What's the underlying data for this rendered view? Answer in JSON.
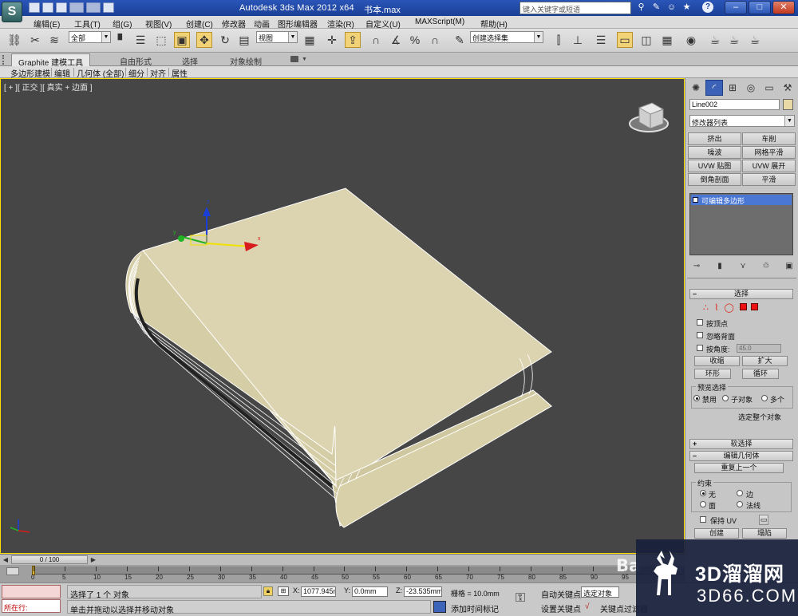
{
  "titlebar": {
    "logo": "S",
    "title": "Autodesk 3ds Max  2012 x64",
    "file": "书本.max",
    "search_placeholder": "键入关键字或短语",
    "icons": [
      "binoculars-icon",
      "wrench-icon",
      "person-icon",
      "star-icon",
      "help-icon"
    ],
    "window_buttons": [
      "–",
      "□",
      "✕"
    ]
  },
  "menubar": {
    "items": [
      "编辑(E)",
      "工具(T)",
      "组(G)",
      "视图(V)",
      "创建(C)",
      "修改器",
      "动画",
      "图形编辑器",
      "渲染(R)",
      "自定义(U)",
      "MAXScript(M)",
      "帮助(H)"
    ]
  },
  "toolbar": {
    "selection_filter": "全部",
    "coord_system": "视图",
    "named_selection": "创建选择集"
  },
  "ribbon": {
    "tabs": [
      "Graphite 建模工具",
      "自由形式",
      "选择",
      "对象绘制"
    ],
    "subtabs": [
      "多边形建模",
      "编辑",
      "几何体 (全部)",
      "细分",
      "对齐",
      "属性"
    ]
  },
  "viewport": {
    "label": "[ + ][ 正交 ][ 真实 + 边面 ]",
    "gizmo_axes": [
      "x",
      "y",
      "z"
    ],
    "colors": {
      "bg": "#464646",
      "book_top": "#dcd4b0",
      "book_edge": "#ffffff"
    }
  },
  "cmdpanel": {
    "tab_icons": [
      "sun-icon",
      "arc-icon",
      "hierarchy-icon",
      "motion-icon",
      "display-icon",
      "hammer-icon"
    ],
    "object_name": "Line002",
    "object_color": "#e8d9a6",
    "modifier_list": "修改器列表",
    "modifier_buttons": [
      "挤出",
      "车削",
      "噪波",
      "网格平滑",
      "UVW 贴图",
      "UVW 展开",
      "倒角剖面",
      "平滑"
    ],
    "stack_item": "可编辑多边形",
    "selection": {
      "title": "选择",
      "by_vertex": "按顶点",
      "ignore_backfacing": "忽略背面",
      "by_angle": "按角度:",
      "angle_value": "45.0",
      "shrink": "收缩",
      "grow": "扩大",
      "ring": "环形",
      "loop": "循环",
      "preview_title": "预览选择",
      "preview_off": "禁用",
      "preview_subobj": "子对象",
      "preview_multi": "多个",
      "whole_object": "选定整个对象"
    },
    "soft_selection": "软选择",
    "edit_geometry": {
      "title": "编辑几何体",
      "repeat_last": "重复上一个",
      "constraints": "约束",
      "none": "无",
      "edge": "边",
      "face": "面",
      "normal": "法线",
      "preserve_uv": "保持 UV",
      "create": "创建",
      "collapse": "塌陷"
    }
  },
  "timeline": {
    "frame": "0 / 100",
    "ticks": [
      "0",
      "5",
      "10",
      "15",
      "20",
      "25",
      "30",
      "35",
      "40",
      "45",
      "50",
      "55",
      "60",
      "65",
      "70",
      "75",
      "80",
      "85",
      "90",
      "95"
    ]
  },
  "status": {
    "listener": "所在行:",
    "selection_info": "选择了 1 个 对象",
    "prompt": "单击并拖动以选择并移动对象",
    "x_label": "X:",
    "x_value": "1077.945m",
    "y_label": "Y:",
    "y_value": "0.0mm",
    "z_label": "Z:",
    "z_value": "-23.535mm",
    "grid": "栅格 = 10.0mm",
    "add_time_tag": "添加时间标记",
    "auto_key": "自动关键点",
    "set_key": "设置关键点",
    "selected": "选定对象",
    "key_filter": "关键点过滤器"
  },
  "watermark": {
    "brand": "3D溜溜网",
    "domain": "3D66.COM",
    "bai": "Ba"
  }
}
